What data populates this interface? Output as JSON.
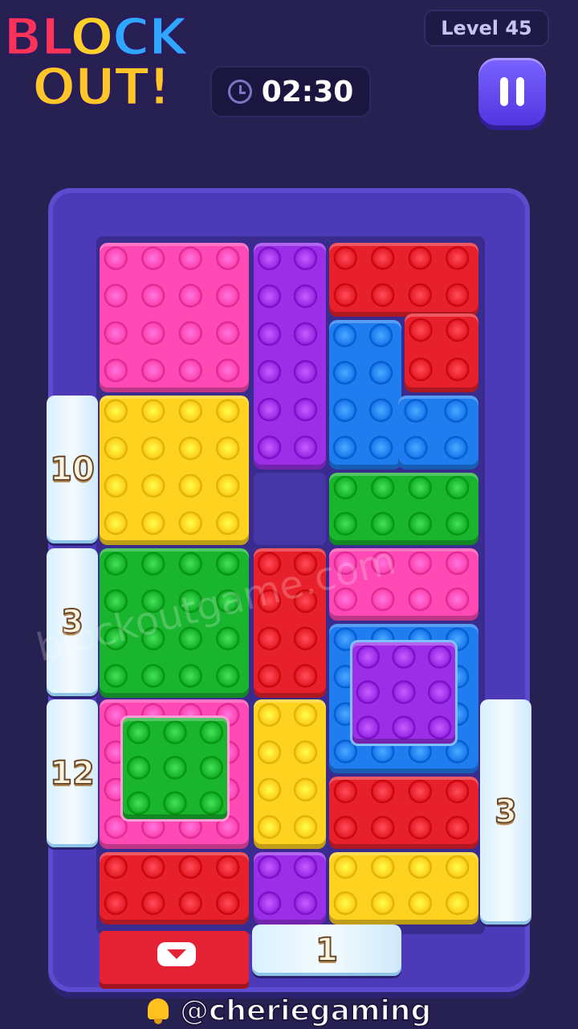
{
  "header": {
    "logo_line1": [
      "BL",
      "O",
      "CK"
    ],
    "logo_line2": "OUT!",
    "level": "Level 45",
    "timer": "02:30"
  },
  "board": {
    "colors": {
      "pink": "#ff49b4",
      "purple": "#9b2fe8",
      "red": "#e8202c",
      "blue": "#1f7df0",
      "yellow": "#ffd21f",
      "green": "#19b52f",
      "frame": "#4c3ab8",
      "empty_cell": "#4736a8"
    },
    "ice_counters": {
      "left_top": "10",
      "left_middle": "3",
      "left_bottom": "12",
      "right": "3",
      "bottom": "1"
    }
  },
  "watermark": "blockoutgame.com",
  "footer": {
    "handle": "@cheriegaming"
  }
}
